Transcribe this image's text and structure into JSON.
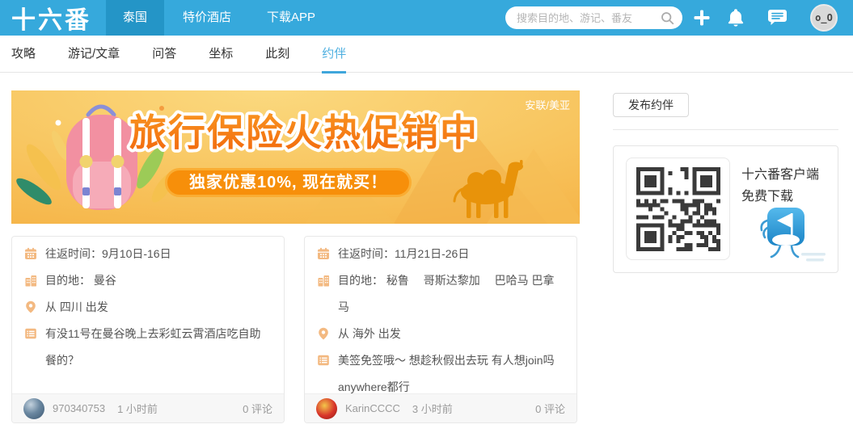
{
  "colors": {
    "header_bg": "#36A9DC",
    "header_active_tab_bg": "#2495C7",
    "accent_blue": "#4DAFE0",
    "banner_title_orange": "#F4740F",
    "banner_pill_orange": "#F78F0A",
    "card_icon_peach": "#F3B981",
    "muted_text": "#9B9B9B"
  },
  "header": {
    "logo": "十六番",
    "tabs": [
      {
        "label": "泰国",
        "active": true
      },
      {
        "label": "特价酒店",
        "active": false
      },
      {
        "label": "下载APP",
        "active": false
      }
    ],
    "search": {
      "placeholder": "搜索目的地、游记、番友"
    },
    "avatar": "o_O"
  },
  "subnav": {
    "tabs": [
      {
        "label": "攻略",
        "active": false
      },
      {
        "label": "游记/文章",
        "active": false
      },
      {
        "label": "问答",
        "active": false
      },
      {
        "label": "坐标",
        "active": false
      },
      {
        "label": "此刻",
        "active": false
      },
      {
        "label": "约伴",
        "active": true
      }
    ]
  },
  "banner": {
    "badge": "安联/美亚",
    "title": "旅行保险火热促销中",
    "pill": "独家优惠10%, 现在就买！"
  },
  "posts": [
    {
      "time": "往返时间：9月10日-16日",
      "destination": "目的地： 曼谷",
      "departure": "从 四川 出发",
      "note": "有没11号在曼谷晚上去彩虹云霄酒店吃自助餐的？",
      "user": "970340753",
      "age": "1 小时前",
      "comments": "0 评论"
    },
    {
      "time": "往返时间：11月21日-26日",
      "destination": "目的地： 秘鲁　 哥斯达黎加　 巴哈马 巴拿马",
      "departure": "从 海外 出发",
      "note": "美签免签哦～ 想趁秋假出去玩 有人想join吗 anywhere都行",
      "user": "KarinCCCC",
      "age": "3 小时前",
      "comments": "0 评论"
    }
  ],
  "sidebar": {
    "publish": "发布约伴",
    "qr": {
      "line1": "十六番客户端",
      "line2": "免费下载"
    }
  }
}
